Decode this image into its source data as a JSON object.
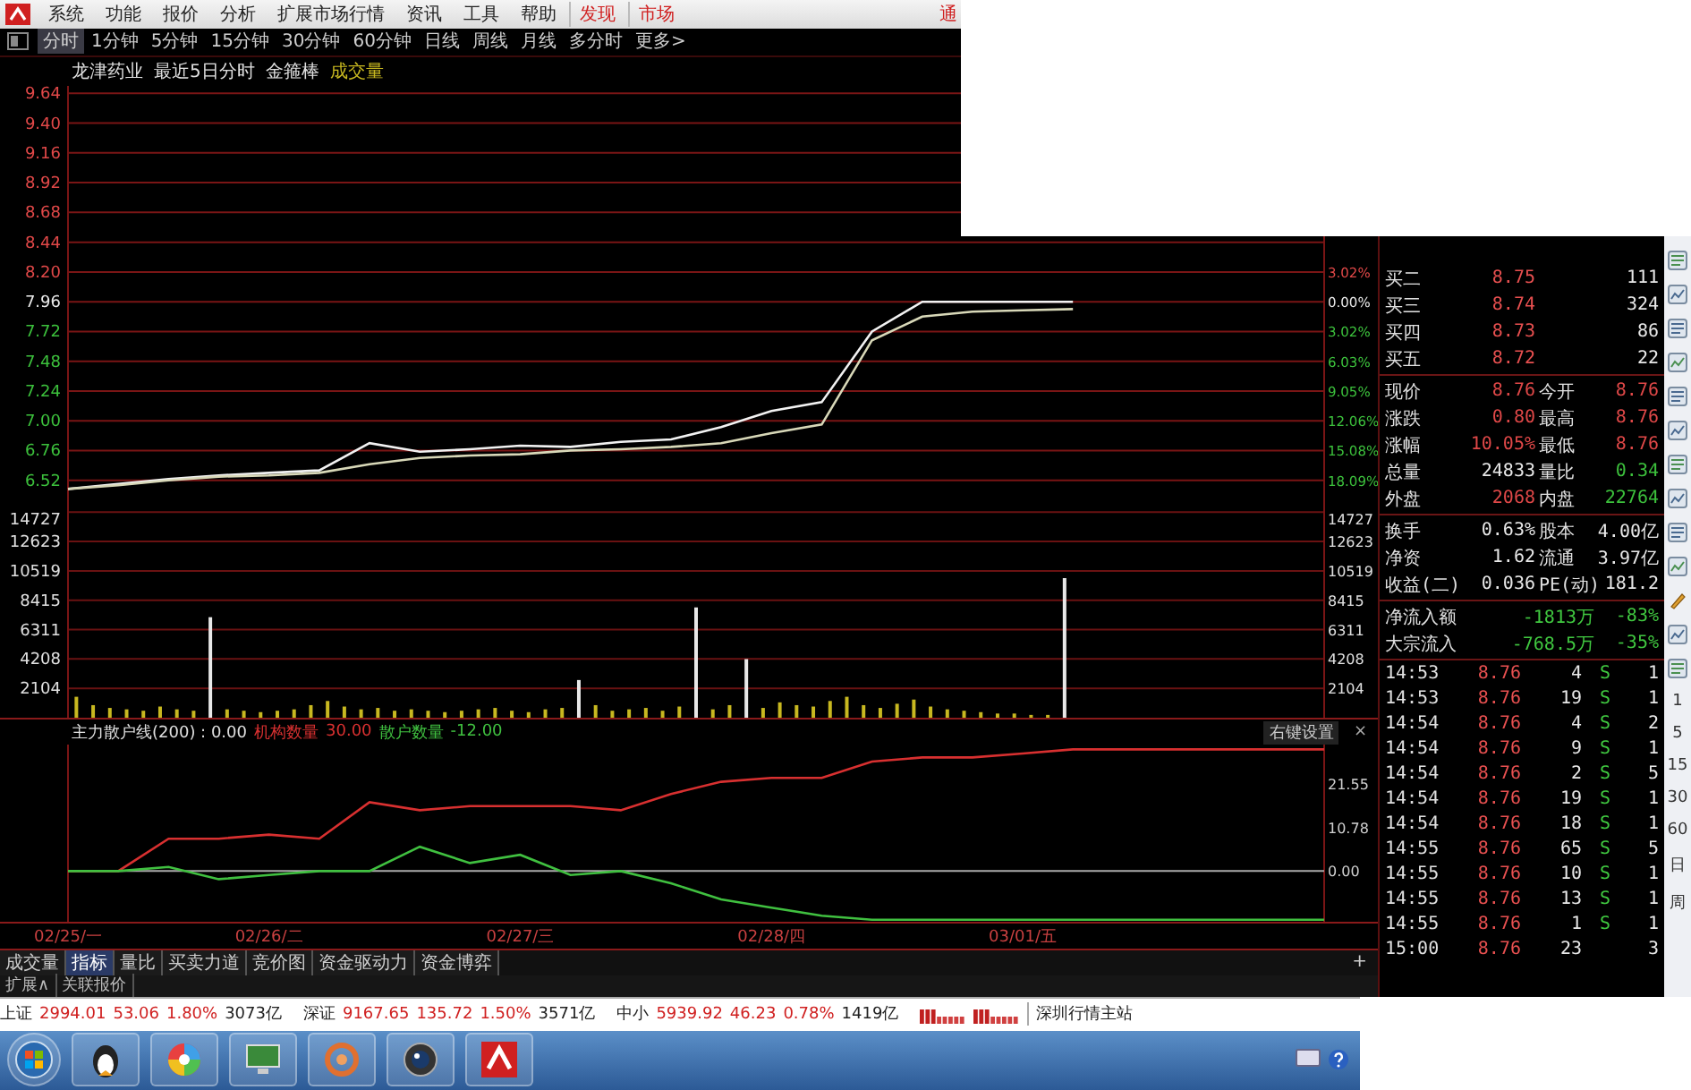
{
  "menu_bar": {
    "items": [
      {
        "label": "系统",
        "kind": "menu"
      },
      {
        "label": "功能",
        "kind": "menu"
      },
      {
        "label": "报价",
        "kind": "menu"
      },
      {
        "label": "分析",
        "kind": "menu"
      },
      {
        "label": "扩展市场行情",
        "kind": "menu"
      },
      {
        "label": "资讯",
        "kind": "menu"
      },
      {
        "label": "工具",
        "kind": "menu"
      },
      {
        "label": "帮助",
        "kind": "menu"
      },
      {
        "label": "发现",
        "kind": "link"
      },
      {
        "label": "市场",
        "kind": "link"
      }
    ],
    "edge_text": "通"
  },
  "period_tabs": [
    {
      "label": "分时",
      "selected": true
    },
    {
      "label": "1分钟",
      "selected": false
    },
    {
      "label": "5分钟",
      "selected": false
    },
    {
      "label": "15分钟",
      "selected": false
    },
    {
      "label": "30分钟",
      "selected": false
    },
    {
      "label": "60分钟",
      "selected": false
    },
    {
      "label": "日线",
      "selected": false
    },
    {
      "label": "周线",
      "selected": false
    },
    {
      "label": "月线",
      "selected": false
    },
    {
      "label": "多分时",
      "selected": false
    },
    {
      "label": "更多>",
      "selected": false
    }
  ],
  "chart_title": {
    "stock": "龙津药业",
    "mode": "最近5日分时",
    "indicator": "金箍棒",
    "volume_label": "成交量"
  },
  "price_chart": {
    "right_labels": [
      {
        "label": "3.02%",
        "color": "#e04848"
      },
      {
        "label": "0.00%",
        "color": "#e8e8e8"
      },
      {
        "label": "3.02%",
        "color": "#3cc03c"
      },
      {
        "label": "6.03%",
        "color": "#3cc03c"
      },
      {
        "label": "9.05%",
        "color": "#3cc03c"
      },
      {
        "label": "12.06%",
        "color": "#3cc03c"
      },
      {
        "label": "15.08%",
        "color": "#3cc03c"
      },
      {
        "label": "18.09%",
        "color": "#3cc03c"
      }
    ],
    "chart_data": {
      "type": "line",
      "grid": true,
      "ylim": [
        6.28,
        9.7
      ],
      "yticks": [
        {
          "value": 9.64,
          "label": "9.64"
        },
        {
          "value": 9.4,
          "label": "9.40"
        },
        {
          "value": 9.16,
          "label": "9.16"
        },
        {
          "value": 8.92,
          "label": "8.92"
        },
        {
          "value": 8.68,
          "label": "8.68"
        },
        {
          "value": 8.44,
          "label": "8.44"
        },
        {
          "value": 8.2,
          "label": "8.20"
        },
        {
          "value": 7.96,
          "label": "7.96"
        },
        {
          "value": 7.72,
          "label": "7.72"
        },
        {
          "value": 7.48,
          "label": "7.48"
        },
        {
          "value": 7.24,
          "label": "7.24"
        },
        {
          "value": 7.0,
          "label": "7.00"
        },
        {
          "value": 6.76,
          "label": "6.76"
        },
        {
          "value": 6.52,
          "label": "6.52"
        }
      ],
      "categories": [
        null,
        null,
        null,
        null,
        null,
        null,
        null,
        null,
        null,
        null,
        null,
        null,
        null,
        null,
        null,
        null,
        null,
        null,
        null,
        null,
        null,
        null,
        null,
        null,
        null,
        null
      ],
      "series": [
        {
          "color": "#f2f2f2",
          "values": [
            6.45,
            6.49,
            6.53,
            6.56,
            6.58,
            6.6,
            6.82,
            6.75,
            6.77,
            6.8,
            6.79,
            6.83,
            6.85,
            6.95,
            7.08,
            7.15,
            7.72,
            7.96,
            7.96,
            7.96,
            7.96,
            null,
            null,
            null,
            null,
            null
          ]
        },
        {
          "color": "#d8d8b8",
          "values": [
            6.45,
            6.48,
            6.52,
            6.55,
            6.56,
            6.58,
            6.65,
            6.7,
            6.72,
            6.73,
            6.76,
            6.77,
            6.79,
            6.82,
            6.9,
            6.97,
            7.65,
            7.84,
            7.88,
            7.89,
            7.9,
            null,
            null,
            null,
            null,
            null
          ]
        }
      ]
    }
  },
  "volume_chart": {
    "chart_data": {
      "type": "bar",
      "grid": true,
      "ylim": [
        0,
        15000
      ],
      "yticks": [
        {
          "value": 14727,
          "label": "14727"
        },
        {
          "value": 12623,
          "label": "12623"
        },
        {
          "value": 10519,
          "label": "10519"
        },
        {
          "value": 8415,
          "label": "8415"
        },
        {
          "value": 6311,
          "label": "6311"
        },
        {
          "value": 4208,
          "label": "4208"
        },
        {
          "value": 2104,
          "label": "2104"
        }
      ],
      "categories": [
        null,
        null,
        null,
        null,
        null,
        null,
        null,
        null,
        null,
        null,
        null,
        null,
        null,
        null,
        null,
        null,
        null,
        null,
        null,
        null,
        null,
        null,
        null,
        null,
        null,
        null,
        null,
        null,
        null,
        null,
        null,
        null,
        null,
        null,
        null,
        null,
        null,
        null,
        null,
        null,
        null,
        null,
        null,
        null,
        null,
        null,
        null,
        null,
        null,
        null,
        null,
        null,
        null,
        null,
        null,
        null,
        null,
        null,
        null,
        null,
        null,
        null,
        null,
        null,
        null,
        null,
        null,
        null,
        null,
        null,
        null,
        null,
        null,
        null,
        null
      ],
      "series": [
        {
          "color": "#c8b820",
          "values": [
            1500,
            900,
            700,
            600,
            500,
            800,
            600,
            500,
            null,
            600,
            500,
            400,
            500,
            600,
            900,
            1200,
            800,
            600,
            700,
            500,
            600,
            500,
            400,
            500,
            600,
            700,
            500,
            400,
            600,
            700,
            null,
            900,
            500,
            600,
            700,
            500,
            800,
            null,
            600,
            900,
            null,
            700,
            1100,
            900,
            800,
            1200,
            1500,
            900,
            700,
            1000,
            1300,
            800,
            600,
            500,
            400,
            300,
            300,
            200,
            200,
            null,
            null,
            null,
            null,
            null,
            null,
            null,
            null,
            null,
            null,
            null,
            null,
            null,
            null,
            null,
            null
          ]
        },
        {
          "color": "#e8e8e8",
          "values": [
            null,
            null,
            null,
            null,
            null,
            null,
            null,
            null,
            7200,
            null,
            null,
            null,
            null,
            null,
            null,
            null,
            null,
            null,
            null,
            null,
            null,
            null,
            null,
            null,
            null,
            null,
            null,
            null,
            null,
            null,
            2700,
            null,
            null,
            null,
            null,
            null,
            null,
            7900,
            null,
            null,
            4200,
            null,
            null,
            null,
            null,
            null,
            null,
            null,
            null,
            null,
            null,
            null,
            null,
            null,
            null,
            null,
            null,
            null,
            null,
            10000,
            null,
            null,
            null,
            null,
            null,
            null,
            null,
            null,
            null,
            null,
            null,
            null,
            null,
            null,
            null
          ]
        }
      ]
    }
  },
  "indicator": {
    "name": "主力散户线(200) : 0.00",
    "legend_values": [
      "30.00",
      "-12.00"
    ],
    "settings_label": "右键设置",
    "close_label": "×",
    "chart_data": {
      "type": "line",
      "ylim": [
        -12.5,
        31.2
      ],
      "yticks": [
        {
          "value": 21.55,
          "label": "21.55"
        },
        {
          "value": 10.78,
          "label": "10.78"
        },
        {
          "value": 0,
          "label": "0.00"
        }
      ],
      "categories": [
        "02/25/一",
        null,
        null,
        null,
        "02/26/二",
        null,
        null,
        null,
        null,
        "02/27/三",
        null,
        null,
        null,
        null,
        "02/28/四",
        null,
        null,
        null,
        null,
        "03/01/五",
        null,
        null,
        null,
        null,
        null,
        null
      ],
      "series": [
        {
          "name": "机构数量",
          "color": "#d83030",
          "values": [
            0,
            0,
            8,
            8,
            9,
            8,
            17,
            15,
            16,
            16,
            16,
            15,
            19,
            22,
            23,
            23,
            27,
            28,
            28,
            29,
            30,
            30,
            30,
            30,
            30,
            30
          ]
        },
        {
          "name": "散户数量",
          "color": "#40c040",
          "values": [
            0,
            0,
            1,
            -2,
            -1,
            0,
            0,
            6,
            2,
            4,
            -1,
            0,
            -3,
            -7,
            -9,
            -11,
            -12,
            -12,
            -12,
            -12,
            -12,
            -12,
            -12,
            -12,
            -12,
            -12
          ]
        }
      ]
    }
  },
  "bottom_tabs": [
    {
      "label": "成交量",
      "selected": false
    },
    {
      "label": "指标",
      "selected": true
    },
    {
      "label": "量比",
      "selected": false
    },
    {
      "label": "买卖力道",
      "selected": false
    },
    {
      "label": "竞价图",
      "selected": false
    },
    {
      "label": "资金驱动力",
      "selected": false
    },
    {
      "label": "资金博弈",
      "selected": false
    }
  ],
  "add_tab_label": "+",
  "extra_tabs": [
    {
      "label": "扩展∧"
    },
    {
      "label": "关联报价"
    }
  ],
  "order_book": [
    {
      "label": "买二",
      "price": "8.75",
      "volume": "111"
    },
    {
      "label": "买三",
      "price": "8.74",
      "volume": "324"
    },
    {
      "label": "买四",
      "price": "8.73",
      "volume": "86"
    },
    {
      "label": "买五",
      "price": "8.72",
      "volume": "22"
    }
  ],
  "quote_groups": [
    [
      {
        "label": "现价",
        "value": {
          "text": "8.76",
          "color": "#e04848"
        },
        "label2": "今开",
        "value2": {
          "text": "8.76",
          "color": "#e04848"
        }
      },
      {
        "label": "涨跌",
        "value": {
          "text": "0.80",
          "color": "#e04848"
        },
        "label2": "最高",
        "value2": {
          "text": "8.76",
          "color": "#e04848"
        }
      },
      {
        "label": "涨幅",
        "value": {
          "text": "10.05%",
          "color": "#e04848"
        },
        "label2": "最低",
        "value2": {
          "text": "8.76",
          "color": "#e04848"
        }
      },
      {
        "label": "总量",
        "value": {
          "text": "24833",
          "color": "#e8e8e8"
        },
        "label2": "量比",
        "value2": {
          "text": "0.34",
          "color": "#3cc03c"
        }
      },
      {
        "label": "外盘",
        "value": {
          "text": "2068",
          "color": "#e04848"
        },
        "label2": "内盘",
        "value2": {
          "text": "22764",
          "color": "#3cc03c"
        }
      }
    ],
    [
      {
        "label": "换手",
        "value": {
          "text": "0.63%",
          "color": "#e8e8e8"
        },
        "label2": "股本",
        "value2": {
          "text": "4.00亿",
          "color": "#e8e8e8"
        }
      },
      {
        "label": "净资",
        "value": {
          "text": "1.62",
          "color": "#e8e8e8"
        },
        "label2": "流通",
        "value2": {
          "text": "3.97亿",
          "color": "#e8e8e8"
        }
      },
      {
        "label": "收益(二)",
        "value": {
          "text": "0.036",
          "color": "#e8e8e8"
        },
        "label2": "PE(动)",
        "value2": {
          "text": "181.2",
          "color": "#e8e8e8"
        }
      }
    ]
  ],
  "fund_flow": [
    {
      "label": "净流入额",
      "amount": "-1813万",
      "share": "-83%"
    },
    {
      "label": "大宗流入",
      "amount": "-768.5万",
      "share": "-35%"
    }
  ],
  "trades": [
    {
      "time": "14:53",
      "price": "8.76",
      "volume": "4",
      "side": "S",
      "count": "1"
    },
    {
      "time": "14:53",
      "price": "8.76",
      "volume": "19",
      "side": "S",
      "count": "1"
    },
    {
      "time": "14:54",
      "price": "8.76",
      "volume": "4",
      "side": "S",
      "count": "2"
    },
    {
      "time": "14:54",
      "price": "8.76",
      "volume": "9",
      "side": "S",
      "count": "1"
    },
    {
      "time": "14:54",
      "price": "8.76",
      "volume": "2",
      "side": "S",
      "count": "5"
    },
    {
      "time": "14:54",
      "price": "8.76",
      "volume": "19",
      "side": "S",
      "count": "1"
    },
    {
      "time": "14:54",
      "price": "8.76",
      "volume": "18",
      "side": "S",
      "count": "1"
    },
    {
      "time": "14:55",
      "price": "8.76",
      "volume": "65",
      "side": "S",
      "count": "5"
    },
    {
      "time": "14:55",
      "price": "8.76",
      "volume": "10",
      "side": "S",
      "count": "1"
    },
    {
      "time": "14:55",
      "price": "8.76",
      "volume": "13",
      "side": "S",
      "count": "1"
    },
    {
      "time": "14:55",
      "price": "8.76",
      "volume": "1",
      "side": "S",
      "count": "1"
    },
    {
      "time": "15:00",
      "price": "8.76",
      "volume": "23",
      "count": "3"
    }
  ],
  "period_shortcuts": [
    "1",
    "5",
    "15",
    "30",
    "60",
    "日",
    "周"
  ],
  "status_bar": {
    "indices": [
      {
        "name": "上证",
        "value": "2994.01",
        "change": "53.06",
        "pct": "1.80%",
        "amount": "3073亿"
      },
      {
        "name": "深证",
        "value": "9167.65",
        "change": "135.72",
        "pct": "1.50%",
        "amount": "3571亿"
      },
      {
        "name": "中小",
        "value": "5939.92",
        "change": "46.23",
        "pct": "0.78%",
        "amount": "1419亿"
      }
    ],
    "server": "深圳行情主站"
  }
}
